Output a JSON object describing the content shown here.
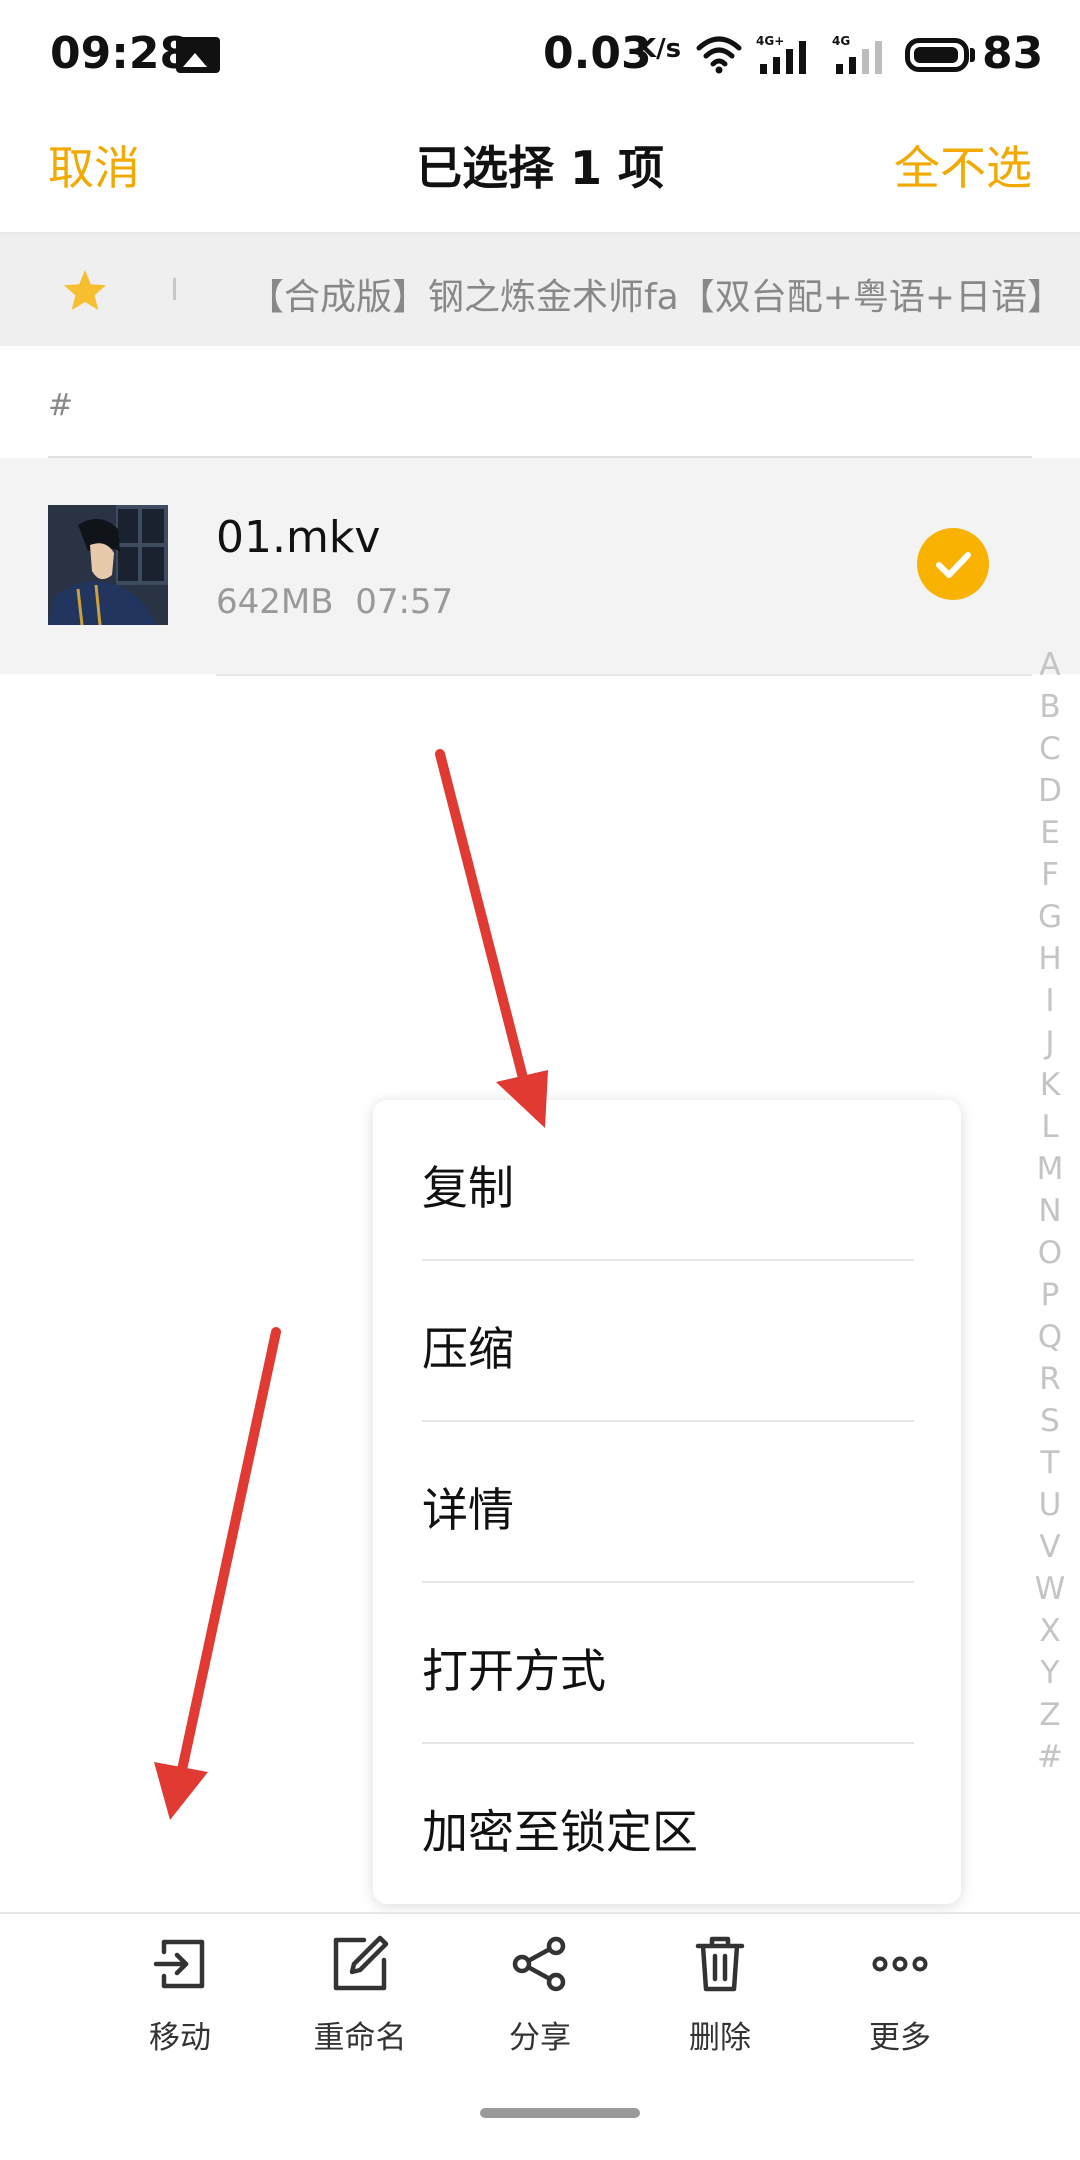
{
  "status_bar": {
    "time": "09:28",
    "speed": "0.03",
    "speed_unit": "K/s",
    "signal1_label": "4G+",
    "signal2_label": "4G",
    "battery": "83"
  },
  "header": {
    "cancel_label": "取消",
    "title": "已选择 1 项",
    "deselect_all_label": "全不选"
  },
  "breadcrumb": {
    "folder": "【合成版】钢之炼金术师fa【双台配+粤语+日语】"
  },
  "section": {
    "letter": "#"
  },
  "files": [
    {
      "name": "01.mkv",
      "size": "642MB",
      "duration": "07:57",
      "selected": true
    }
  ],
  "alphabet": [
    "A",
    "B",
    "C",
    "D",
    "E",
    "F",
    "G",
    "H",
    "I",
    "J",
    "K",
    "L",
    "M",
    "N",
    "O",
    "P",
    "Q",
    "R",
    "S",
    "T",
    "U",
    "V",
    "W",
    "X",
    "Y",
    "Z",
    "#"
  ],
  "context_menu": {
    "items": [
      "复制",
      "压缩",
      "详情",
      "打开方式",
      "加密至锁定区"
    ]
  },
  "toolbar": {
    "items": [
      {
        "label": "移动",
        "icon": "move-icon"
      },
      {
        "label": "重命名",
        "icon": "rename-icon"
      },
      {
        "label": "分享",
        "icon": "share-icon"
      },
      {
        "label": "删除",
        "icon": "delete-icon"
      },
      {
        "label": "更多",
        "icon": "more-icon"
      }
    ]
  },
  "colors": {
    "accent": "#f2a900",
    "check": "#f9b200",
    "annotation_arrow": "#e03a32"
  }
}
